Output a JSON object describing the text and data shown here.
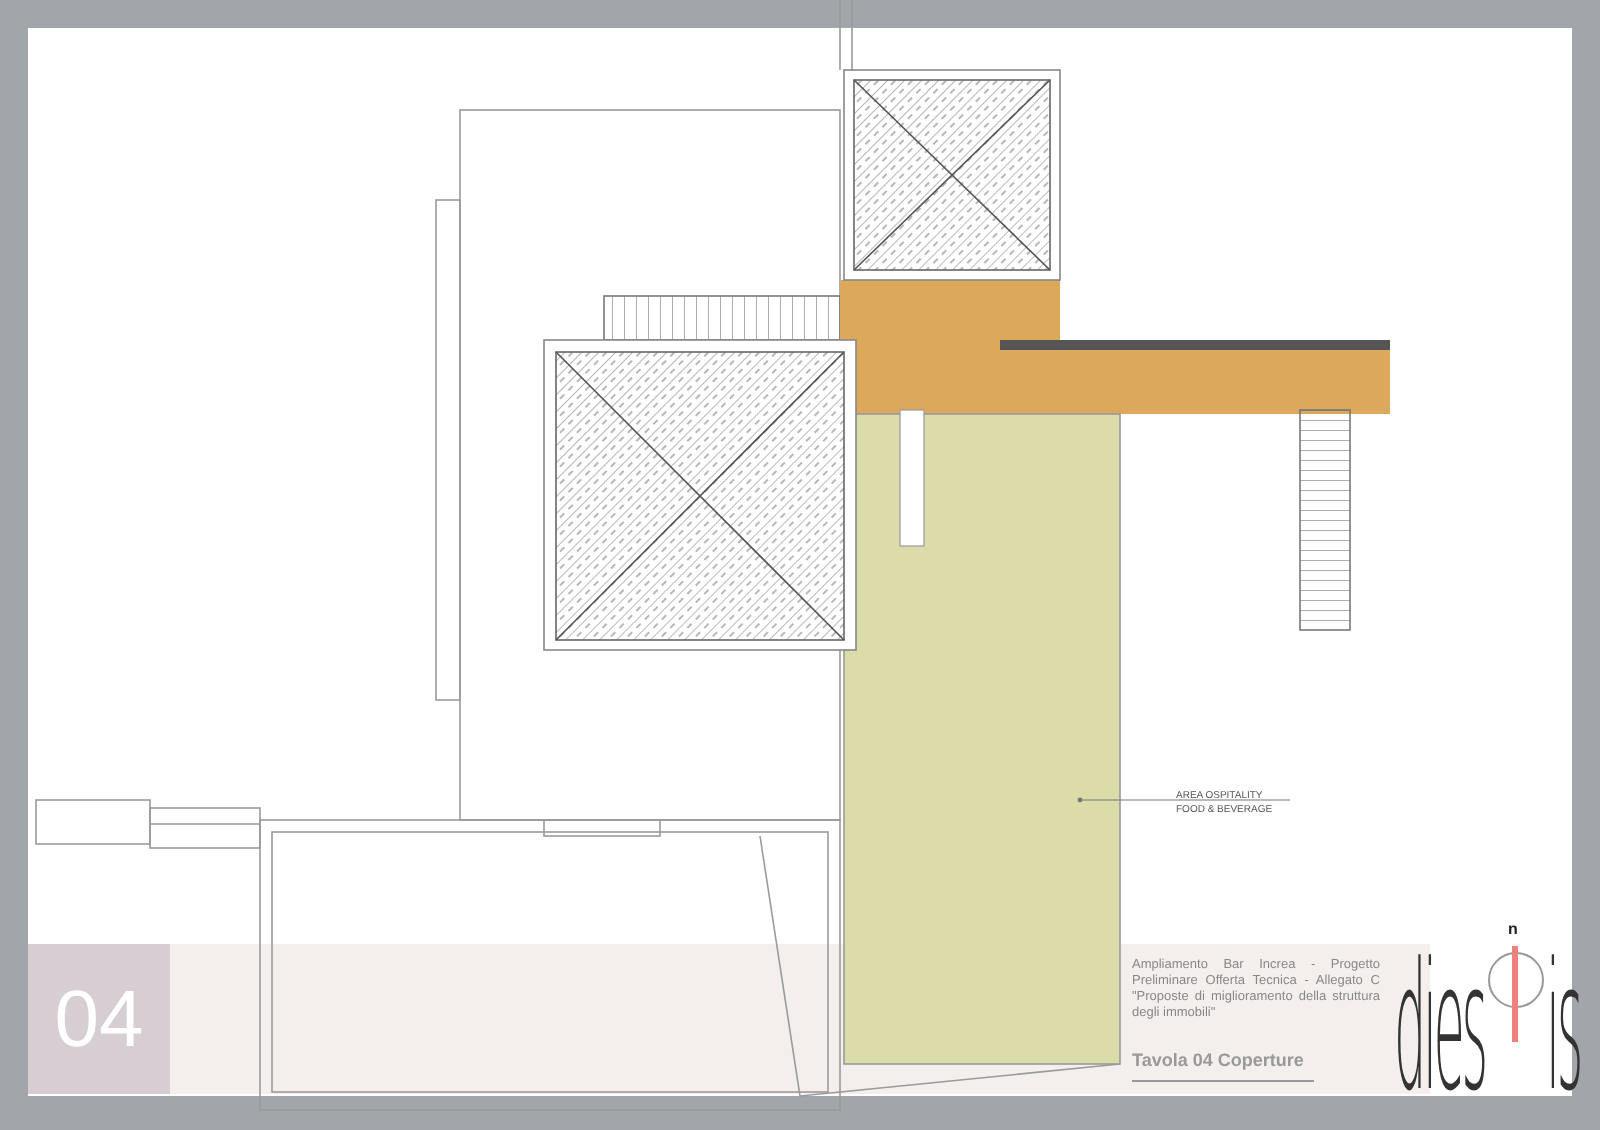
{
  "sheet": {
    "number": "04",
    "plan": {
      "area_label": [
        "AREA OSPITALITY",
        "FOOD & BEVERAGE"
      ]
    },
    "title_block": {
      "description": "Ampliamento Bar Increa - Progetto Preliminare Offerta Tecnica - Allegato C \"Proposte di miglioramento della struttura degli immobili\"",
      "sheet_title": "Tavola 04 Coperture"
    },
    "logo": {
      "left": "dies",
      "right": "is",
      "mark": "n"
    }
  }
}
